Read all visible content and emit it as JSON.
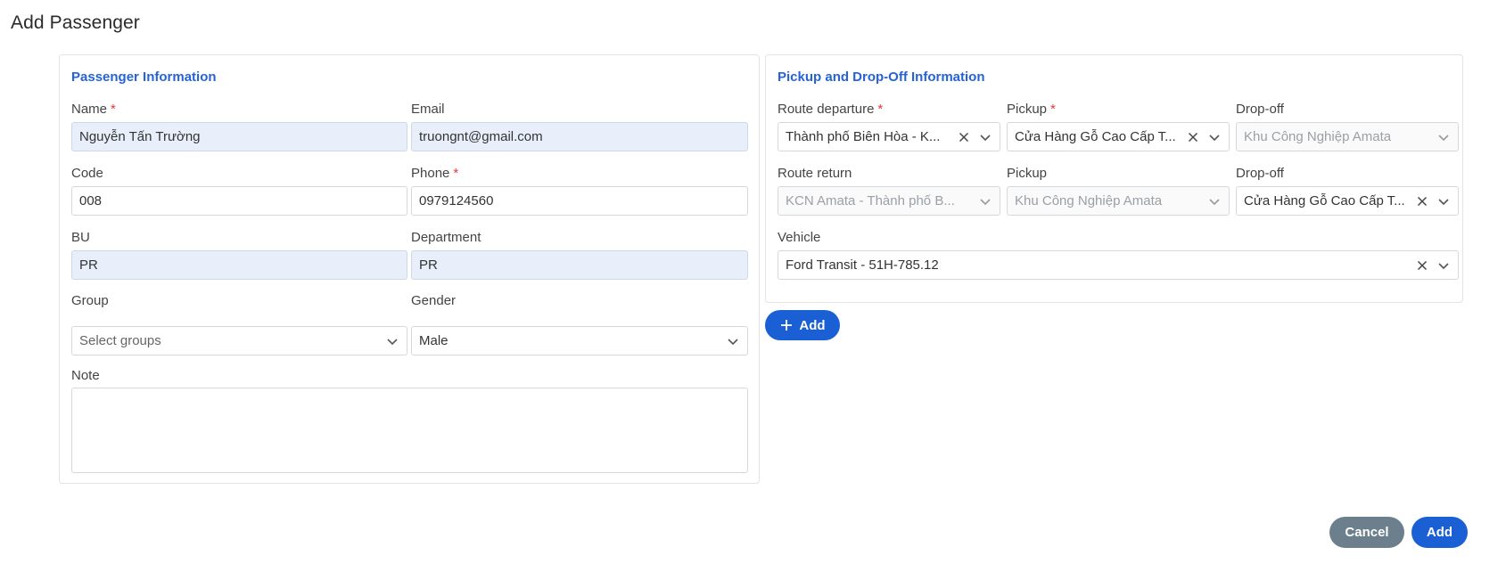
{
  "page": {
    "title": "Add Passenger"
  },
  "passenger": {
    "section_title": "Passenger Information",
    "name": {
      "label": "Name",
      "value": "Nguyễn Tấn Trường"
    },
    "email": {
      "label": "Email",
      "value": "truongnt@gmail.com"
    },
    "code": {
      "label": "Code",
      "value": "008"
    },
    "phone": {
      "label": "Phone",
      "value": "0979124560"
    },
    "bu": {
      "label": "BU",
      "value": "PR"
    },
    "department": {
      "label": "Department",
      "value": "PR"
    },
    "group": {
      "label": "Group",
      "placeholder": "Select groups"
    },
    "gender": {
      "label": "Gender",
      "value": "Male"
    },
    "note": {
      "label": "Note",
      "value": ""
    },
    "required_mark": "*"
  },
  "pickup": {
    "section_title": "Pickup and Drop-Off Information",
    "route_departure": {
      "label": "Route departure",
      "value": "Thành phố Biên Hòa - K..."
    },
    "departure_pickup": {
      "label": "Pickup",
      "value": "Cửa Hàng Gỗ Cao Cấp T..."
    },
    "departure_dropoff": {
      "label": "Drop-off",
      "value": "Khu Công Nghiệp Amata"
    },
    "route_return": {
      "label": "Route return",
      "value": "KCN Amata - Thành phố B..."
    },
    "return_pickup": {
      "label": "Pickup",
      "value": "Khu Công Nghiệp Amata"
    },
    "return_dropoff": {
      "label": "Drop-off",
      "value": "Cửa Hàng Gỗ Cao Cấp T..."
    },
    "vehicle": {
      "label": "Vehicle",
      "value": "Ford Transit - 51H-785.12"
    },
    "add_button": "Add",
    "required_mark": "*"
  },
  "footer": {
    "cancel_label": "Cancel",
    "add_label": "Add"
  },
  "colors": {
    "accent": "#1a5fd4",
    "section_title": "#2563d6",
    "cancel": "#6b7f8c",
    "filled_bg": "#e8effb",
    "required": "#e53935"
  },
  "icons": {
    "clear": "close-icon",
    "dropdown": "chevron-down-icon",
    "add": "plus-icon"
  }
}
